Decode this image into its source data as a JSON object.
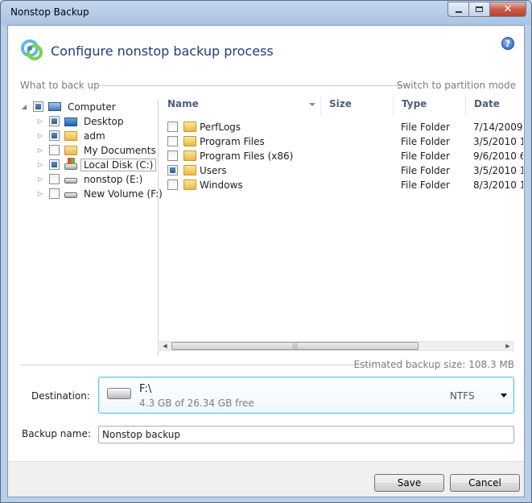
{
  "window": {
    "title": "Nonstop Backup"
  },
  "header": {
    "title": "Configure nonstop backup process"
  },
  "section": {
    "left": "What to back up",
    "right": "Switch to partition mode"
  },
  "tree": {
    "items": [
      {
        "label": "Computer",
        "icon": "computer-icon",
        "state": "partial",
        "expanded": true
      },
      {
        "label": "Desktop",
        "icon": "desktop-icon",
        "state": "partial"
      },
      {
        "label": "adm",
        "icon": "user-folder-icon",
        "state": "partial"
      },
      {
        "label": "My Documents",
        "icon": "documents-folder-icon",
        "state": "unchecked"
      },
      {
        "label": "Local Disk (C:)",
        "icon": "system-disk-icon",
        "state": "partial",
        "selected": true
      },
      {
        "label": "nonstop (E:)",
        "icon": "disk-icon",
        "state": "unchecked"
      },
      {
        "label": "New Volume (F:)",
        "icon": "disk-icon",
        "state": "unchecked"
      }
    ]
  },
  "filelist": {
    "columns": [
      "Name",
      "Size",
      "Type",
      "Date"
    ],
    "rows": [
      {
        "name": "PerfLogs",
        "size": "",
        "type": "File Folder",
        "date": "7/14/2009",
        "state": "unchecked"
      },
      {
        "name": "Program Files",
        "size": "",
        "type": "File Folder",
        "date": "3/5/2010 1",
        "state": "unchecked"
      },
      {
        "name": "Program Files (x86)",
        "size": "",
        "type": "File Folder",
        "date": "9/6/2010 6",
        "state": "unchecked"
      },
      {
        "name": "Users",
        "size": "",
        "type": "File Folder",
        "date": "3/5/2010 1",
        "state": "partial"
      },
      {
        "name": "Windows",
        "size": "",
        "type": "File Folder",
        "date": "8/3/2010 1",
        "state": "unchecked"
      }
    ]
  },
  "estimate": {
    "text": "Estimated backup size: 108.3 MB"
  },
  "destination": {
    "label": "Destination:",
    "path": "F:\\",
    "free": "4.3 GB of 26.34 GB free",
    "filesystem": "NTFS"
  },
  "backup_name": {
    "label": "Backup name:",
    "value": "Nonstop backup"
  },
  "footer": {
    "save_label": "Save",
    "cancel_label": "Cancel"
  },
  "colors": {
    "accent": "#1e3e78",
    "selection_border": "#5cc0ec",
    "check_fill": "#2c5e9a"
  }
}
